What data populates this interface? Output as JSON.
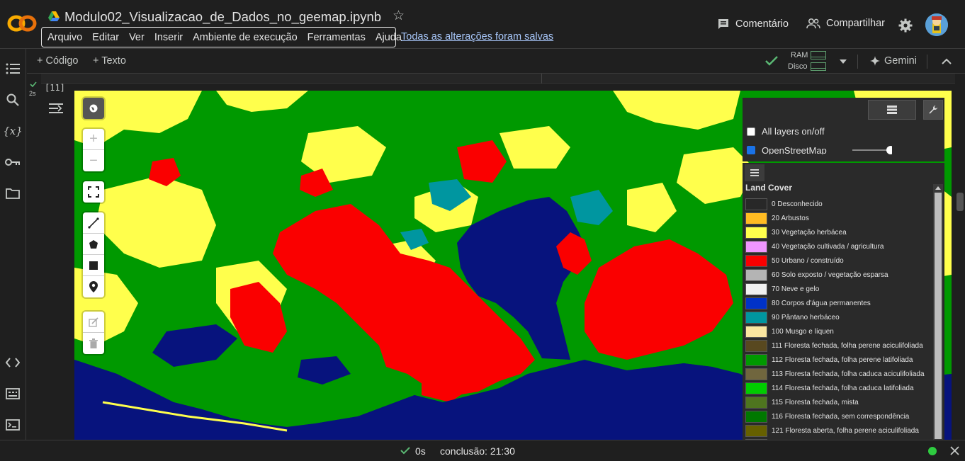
{
  "header": {
    "notebook_title": "Modulo02_Visualizacao_de_Dados_no_geemap.ipynb",
    "menu": [
      "Arquivo",
      "Editar",
      "Ver",
      "Inserir",
      "Ambiente de execução",
      "Ferramentas",
      "Ajuda"
    ],
    "save_status": "Todas as alterações foram salvas",
    "comment_label": "Comentário",
    "share_label": "Compartilhar"
  },
  "toolbar": {
    "add_code_label": "+ Código",
    "add_text_label": "+ Texto",
    "ram_label": "RAM",
    "disk_label": "Disco",
    "gemini_label": "Gemini"
  },
  "cell": {
    "execution_count": "[11]",
    "run_time": "2s"
  },
  "layers_panel": {
    "all_layers_label": "All layers on/off",
    "layer_name": "OpenStreetMap"
  },
  "legend": {
    "title": "Land Cover",
    "items": [
      {
        "label": "0 Desconhecido",
        "color": "#282828"
      },
      {
        "label": "20 Arbustos",
        "color": "#FFBB22"
      },
      {
        "label": "30 Vegetação herbácea",
        "color": "#FFFF4C"
      },
      {
        "label": "40 Vegetação cultivada / agricultura",
        "color": "#F096FF"
      },
      {
        "label": "50 Urbano / construído",
        "color": "#FA0000"
      },
      {
        "label": "60 Solo exposto / vegetação esparsa",
        "color": "#B4B4B4"
      },
      {
        "label": "70 Neve e gelo",
        "color": "#F0F0F0"
      },
      {
        "label": "80 Corpos d'água permanentes",
        "color": "#0032C8"
      },
      {
        "label": "90 Pântano herbáceo",
        "color": "#0096A0"
      },
      {
        "label": "100 Musgo e líquen",
        "color": "#FAE6A0"
      },
      {
        "label": "111 Floresta fechada, folha perene aciculifoliada",
        "color": "#58481F"
      },
      {
        "label": "112 Floresta fechada, folha perene latifoliada",
        "color": "#009900"
      },
      {
        "label": "113 Floresta fechada, folha caduca aciculifoliada",
        "color": "#70663E"
      },
      {
        "label": "114 Floresta fechada, folha caduca latifoliada",
        "color": "#00CC00"
      },
      {
        "label": "115 Floresta fechada, mista",
        "color": "#4E751F"
      },
      {
        "label": "116 Floresta fechada, sem correspondência",
        "color": "#007800"
      },
      {
        "label": "121 Floresta aberta, folha perene aciculifoliada",
        "color": "#666000"
      },
      {
        "label": "",
        "color": "#8DB400"
      }
    ]
  },
  "status": {
    "elapsed": "0s",
    "completion": "conclusão: 21:30"
  }
}
